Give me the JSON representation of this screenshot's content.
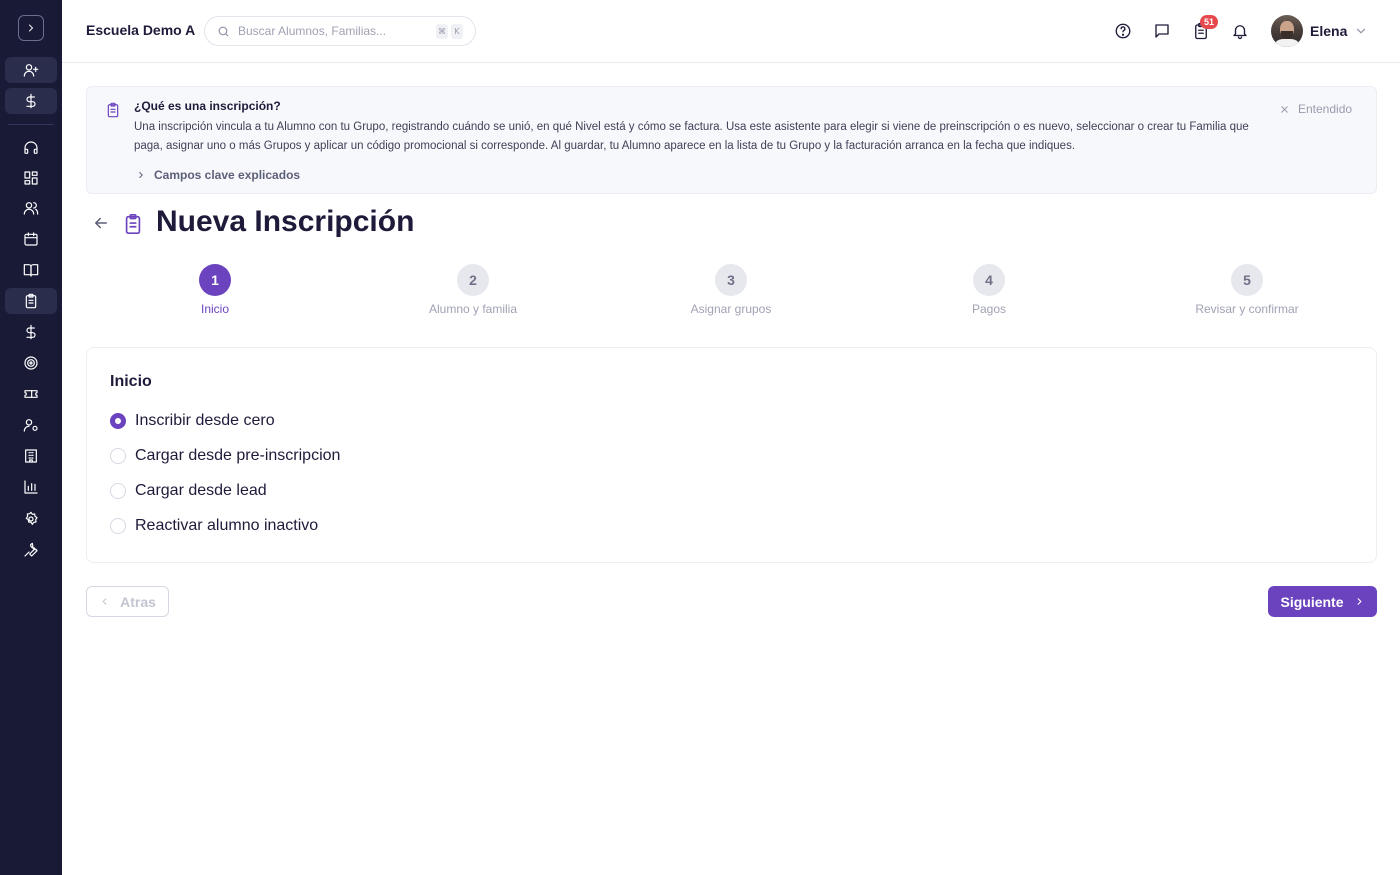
{
  "topbar": {
    "school_name": "Escuela Demo A",
    "search_placeholder": "Buscar Alumnos, Familias...",
    "kbd_cmd": "⌘",
    "kbd_k": "K",
    "notification_count": "51",
    "user_name": "Elena"
  },
  "banner": {
    "title": "¿Qué es una inscripción?",
    "body": "Una inscripción vincula a tu Alumno con tu Grupo, registrando cuándo se unió, en qué Nivel está y cómo se factura. Usa este asistente para elegir si viene de preinscripción o es nuevo, seleccionar o crear tu Familia que paga, asignar uno o más Grupos y aplicar un código promocional si corresponde. Al guardar, tu Alumno aparece en la lista de tu Grupo y la facturación arranca en la fecha que indiques.",
    "dismiss_label": "Entendido",
    "link_label": "Campos clave explicados"
  },
  "page": {
    "title": "Nueva Inscripción"
  },
  "stepper": {
    "steps": [
      {
        "number": "1",
        "label": "Inicio",
        "active": true
      },
      {
        "number": "2",
        "label": "Alumno y familia",
        "active": false
      },
      {
        "number": "3",
        "label": "Asignar grupos",
        "active": false
      },
      {
        "number": "4",
        "label": "Pagos",
        "active": false
      },
      {
        "number": "5",
        "label": "Revisar y confirmar",
        "active": false
      }
    ]
  },
  "card": {
    "title": "Inicio",
    "options": [
      {
        "label": "Inscribir desde cero",
        "selected": true
      },
      {
        "label": "Cargar desde pre-inscripcion",
        "selected": false
      },
      {
        "label": "Cargar desde lead",
        "selected": false
      },
      {
        "label": "Reactivar alumno inactivo",
        "selected": false
      }
    ]
  },
  "footer": {
    "back_label": "Atras",
    "next_label": "Siguiente"
  },
  "colors": {
    "accent": "#6b43bf",
    "sidebar_bg": "#181a36",
    "badge": "#e5484d"
  },
  "sidebar": {
    "icons": [
      "chevron-right-icon",
      "user-plus-icon",
      "dollar-icon",
      "headset-icon",
      "dashboard-icon",
      "users-icon",
      "calendar-icon",
      "book-icon",
      "clipboard-icon",
      "dollar-icon",
      "target-icon",
      "ticket-icon",
      "user-settings-icon",
      "building-icon",
      "bar-chart-icon",
      "gear-icon",
      "wrench-icon"
    ]
  }
}
